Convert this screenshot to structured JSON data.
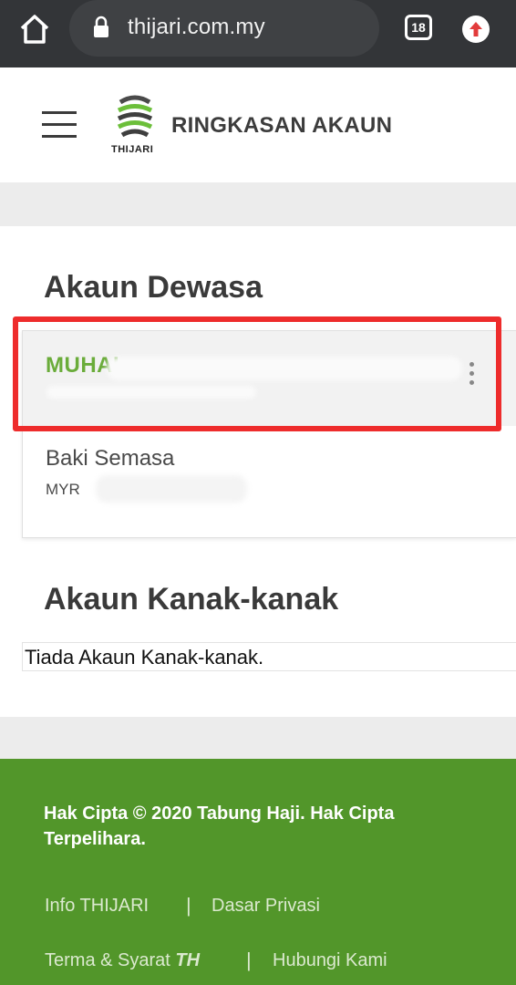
{
  "browser": {
    "url": "thijari.com.my",
    "tab_count": "18"
  },
  "header": {
    "logo_text": "THIJARI",
    "title": "RINGKASAN AKAUN"
  },
  "adult_section": {
    "title": "Akaun Dewasa",
    "account_name": "MUHAI",
    "balance_label": "Baki Semasa",
    "balance_currency": "MYR"
  },
  "child_section": {
    "title": "Akaun Kanak-kanak",
    "empty_message": "Tiada Akaun Kanak-kanak."
  },
  "footer": {
    "copyright": "Hak Cipta © 2020 Tabung Haji. Hak Cipta Terpelihara.",
    "links": {
      "info": "Info THIJARI",
      "privacy": "Dasar Privasi",
      "terms": "Terma & Syarat",
      "terms_suffix": "TH",
      "contact": "Hubungi Kami"
    },
    "separator": "|"
  },
  "colors": {
    "brand_green": "#52962a",
    "account_green": "#6aac3a",
    "highlight_red": "#ee2c2c"
  }
}
